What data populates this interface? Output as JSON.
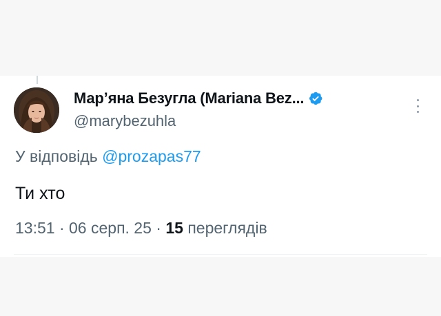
{
  "tweet": {
    "author": {
      "display_name": "Мар’яна Безугла (Mariana Bez...",
      "handle": "@marybezuhla",
      "verified_icon": "verified-badge-icon",
      "avatar_icon": "avatar-photo"
    },
    "reply_to": {
      "prefix": "У відповідь ",
      "handle": "@prozapas77"
    },
    "text": "Ти хто",
    "meta": {
      "time": "13:51",
      "separator": " · ",
      "date": "06 серп. 25",
      "views_count": "15",
      "views_label": " переглядів"
    },
    "more_icon": "more-vertical-icon"
  },
  "colors": {
    "background": "#f7f7f7",
    "card": "#ffffff",
    "primary_text": "#0f1419",
    "secondary_text": "#536471",
    "link": "#1d9bf0",
    "verified": "#1d9bf0"
  }
}
